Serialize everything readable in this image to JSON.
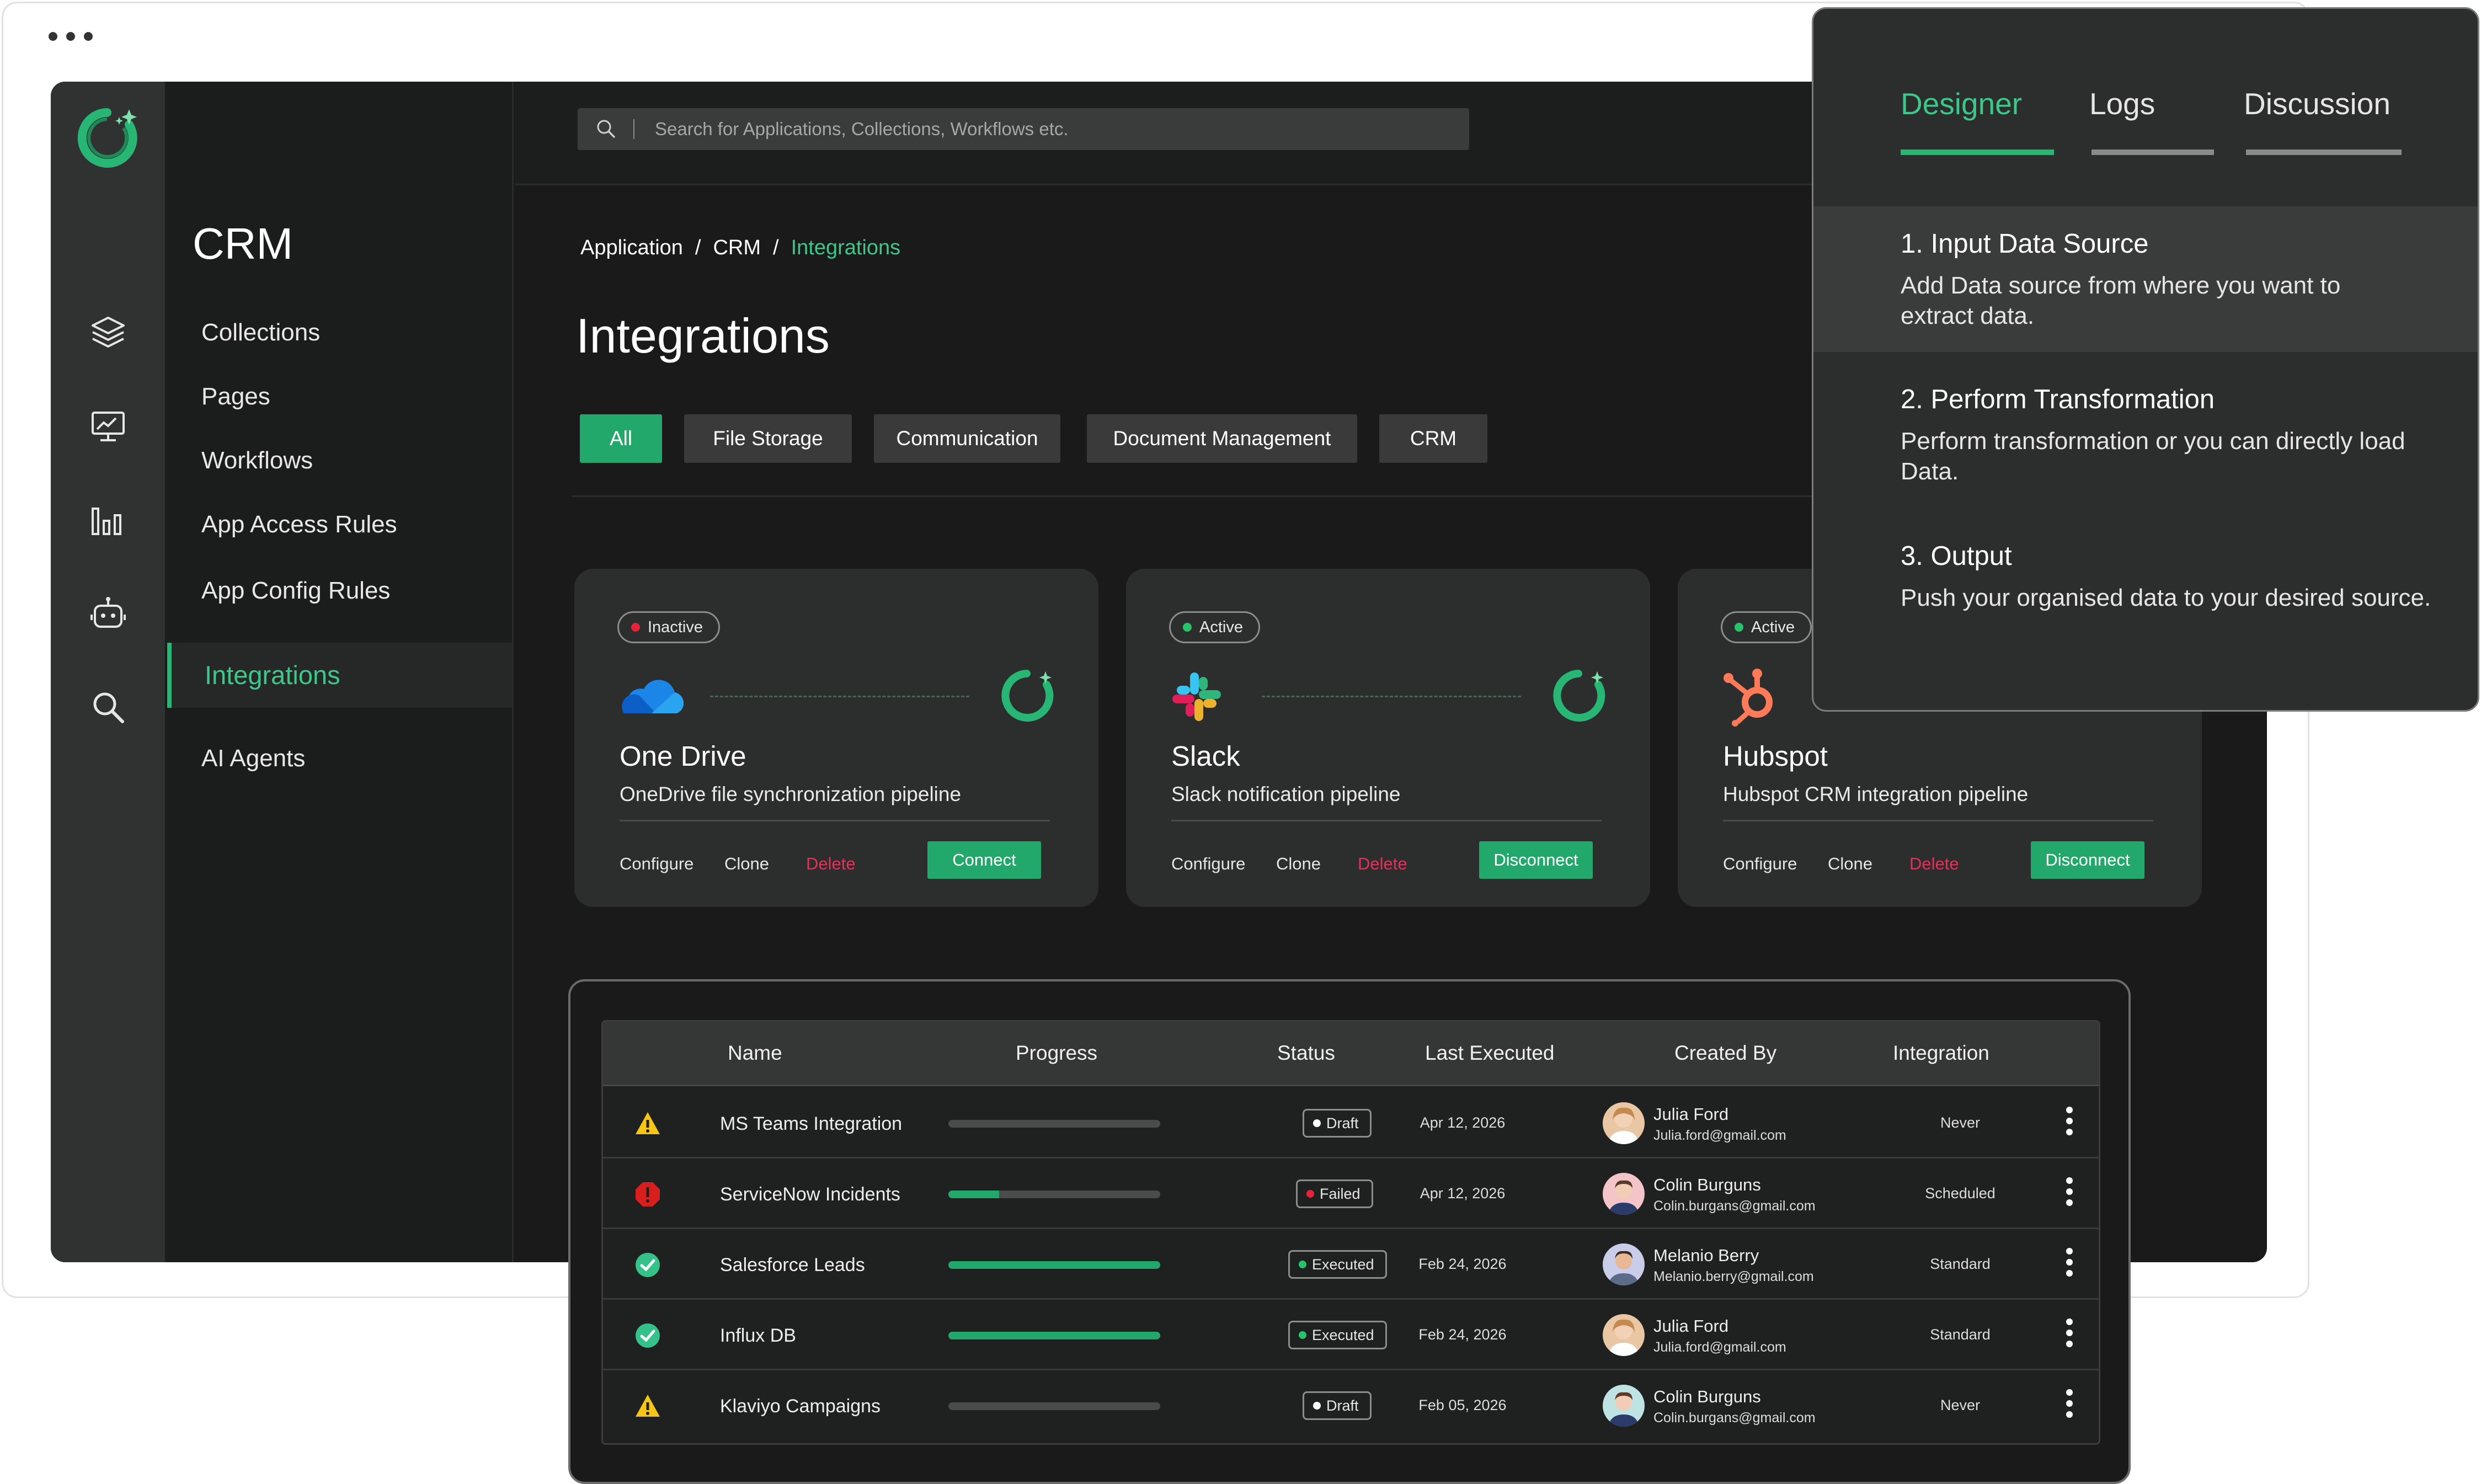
{
  "app": {
    "section_title": "CRM",
    "search_placeholder": "Search for Applications, Collections, Workflows etc.",
    "nav": [
      "Collections",
      "Pages",
      "Workflows",
      "App Access Rules",
      "App Config Rules",
      "Integrations",
      "AI Agents"
    ],
    "active_nav": "Integrations"
  },
  "breadcrumb": {
    "items": [
      "Application",
      "CRM"
    ],
    "current": "Integrations",
    "separator": "/"
  },
  "page_title": "Integrations",
  "filters": [
    "All",
    "File Storage",
    "Communication",
    "Document Management",
    "CRM"
  ],
  "cards": [
    {
      "status": "Inactive",
      "status_color": "#e5243b",
      "name": "One Drive",
      "description": "OneDrive file synchronization pipeline",
      "actions": [
        "Configure",
        "Clone",
        "Delete"
      ],
      "button": "Connect"
    },
    {
      "status": "Active",
      "status_color": "#27c26a",
      "name": "Slack",
      "description": "Slack notification pipeline",
      "actions": [
        "Configure",
        "Clone",
        "Delete"
      ],
      "button": "Disconnect"
    },
    {
      "status": "Active",
      "status_color": "#27c26a",
      "name": "Hubspot",
      "description": "Hubspot CRM integration pipeline",
      "actions": [
        "Configure",
        "Clone",
        "Delete"
      ],
      "button": "Disconnect"
    }
  ],
  "panel": {
    "tabs": [
      "Designer",
      "Logs",
      "Discussion"
    ],
    "active_tab": "Designer",
    "steps": [
      {
        "title": "1.  Input Data Source",
        "desc": "Add Data source from where you want to extract data."
      },
      {
        "title": "2.  Perform Transformation",
        "desc": "Perform transformation or you can directly load Data."
      },
      {
        "title": "3.  Output",
        "desc": "Push your organised data to your desired source."
      }
    ]
  },
  "table": {
    "headers": [
      "Name",
      "Progress",
      "Status",
      "Last Executed",
      "Created By",
      "Integration"
    ],
    "rows": [
      {
        "icon": "warning-icon",
        "name": "MS Teams Integration",
        "progress": 0,
        "status": "Draft",
        "status_color": "#ffffff",
        "last": "Apr 12, 2026",
        "user": "Julia Ford",
        "email": "Julia.ford@gmail.com",
        "integration": "Never"
      },
      {
        "icon": "error-icon",
        "name": "ServiceNow Incidents",
        "progress": 24,
        "status": "Failed",
        "status_color": "#e5243b",
        "last": "Apr 12, 2026",
        "user": "Colin Burguns",
        "email": "Colin.burgans@gmail.com",
        "integration": "Scheduled"
      },
      {
        "icon": "check-circle-icon",
        "name": "Salesforce Leads",
        "progress": 100,
        "status": "Executed",
        "status_color": "#27c26a",
        "last": "Feb 24, 2026",
        "user": "Melanio Berry",
        "email": "Melanio.berry@gmail.com",
        "integration": "Standard"
      },
      {
        "icon": "check-circle-icon",
        "name": "Influx DB",
        "progress": 100,
        "status": "Executed",
        "status_color": "#27c26a",
        "last": "Feb 24, 2026",
        "user": "Julia Ford",
        "email": "Julia.ford@gmail.com",
        "integration": "Standard"
      },
      {
        "icon": "warning-icon",
        "name": "Klaviyo Campaigns",
        "progress": 0,
        "status": "Draft",
        "status_color": "#ffffff",
        "last": "Feb 05, 2026",
        "user": "Colin Burguns",
        "email": "Colin.burgans@gmail.com",
        "integration": "Never"
      }
    ]
  },
  "colors": {
    "accent": "#27b673",
    "danger": "#ef2b5a",
    "warning": "#f5c518"
  }
}
